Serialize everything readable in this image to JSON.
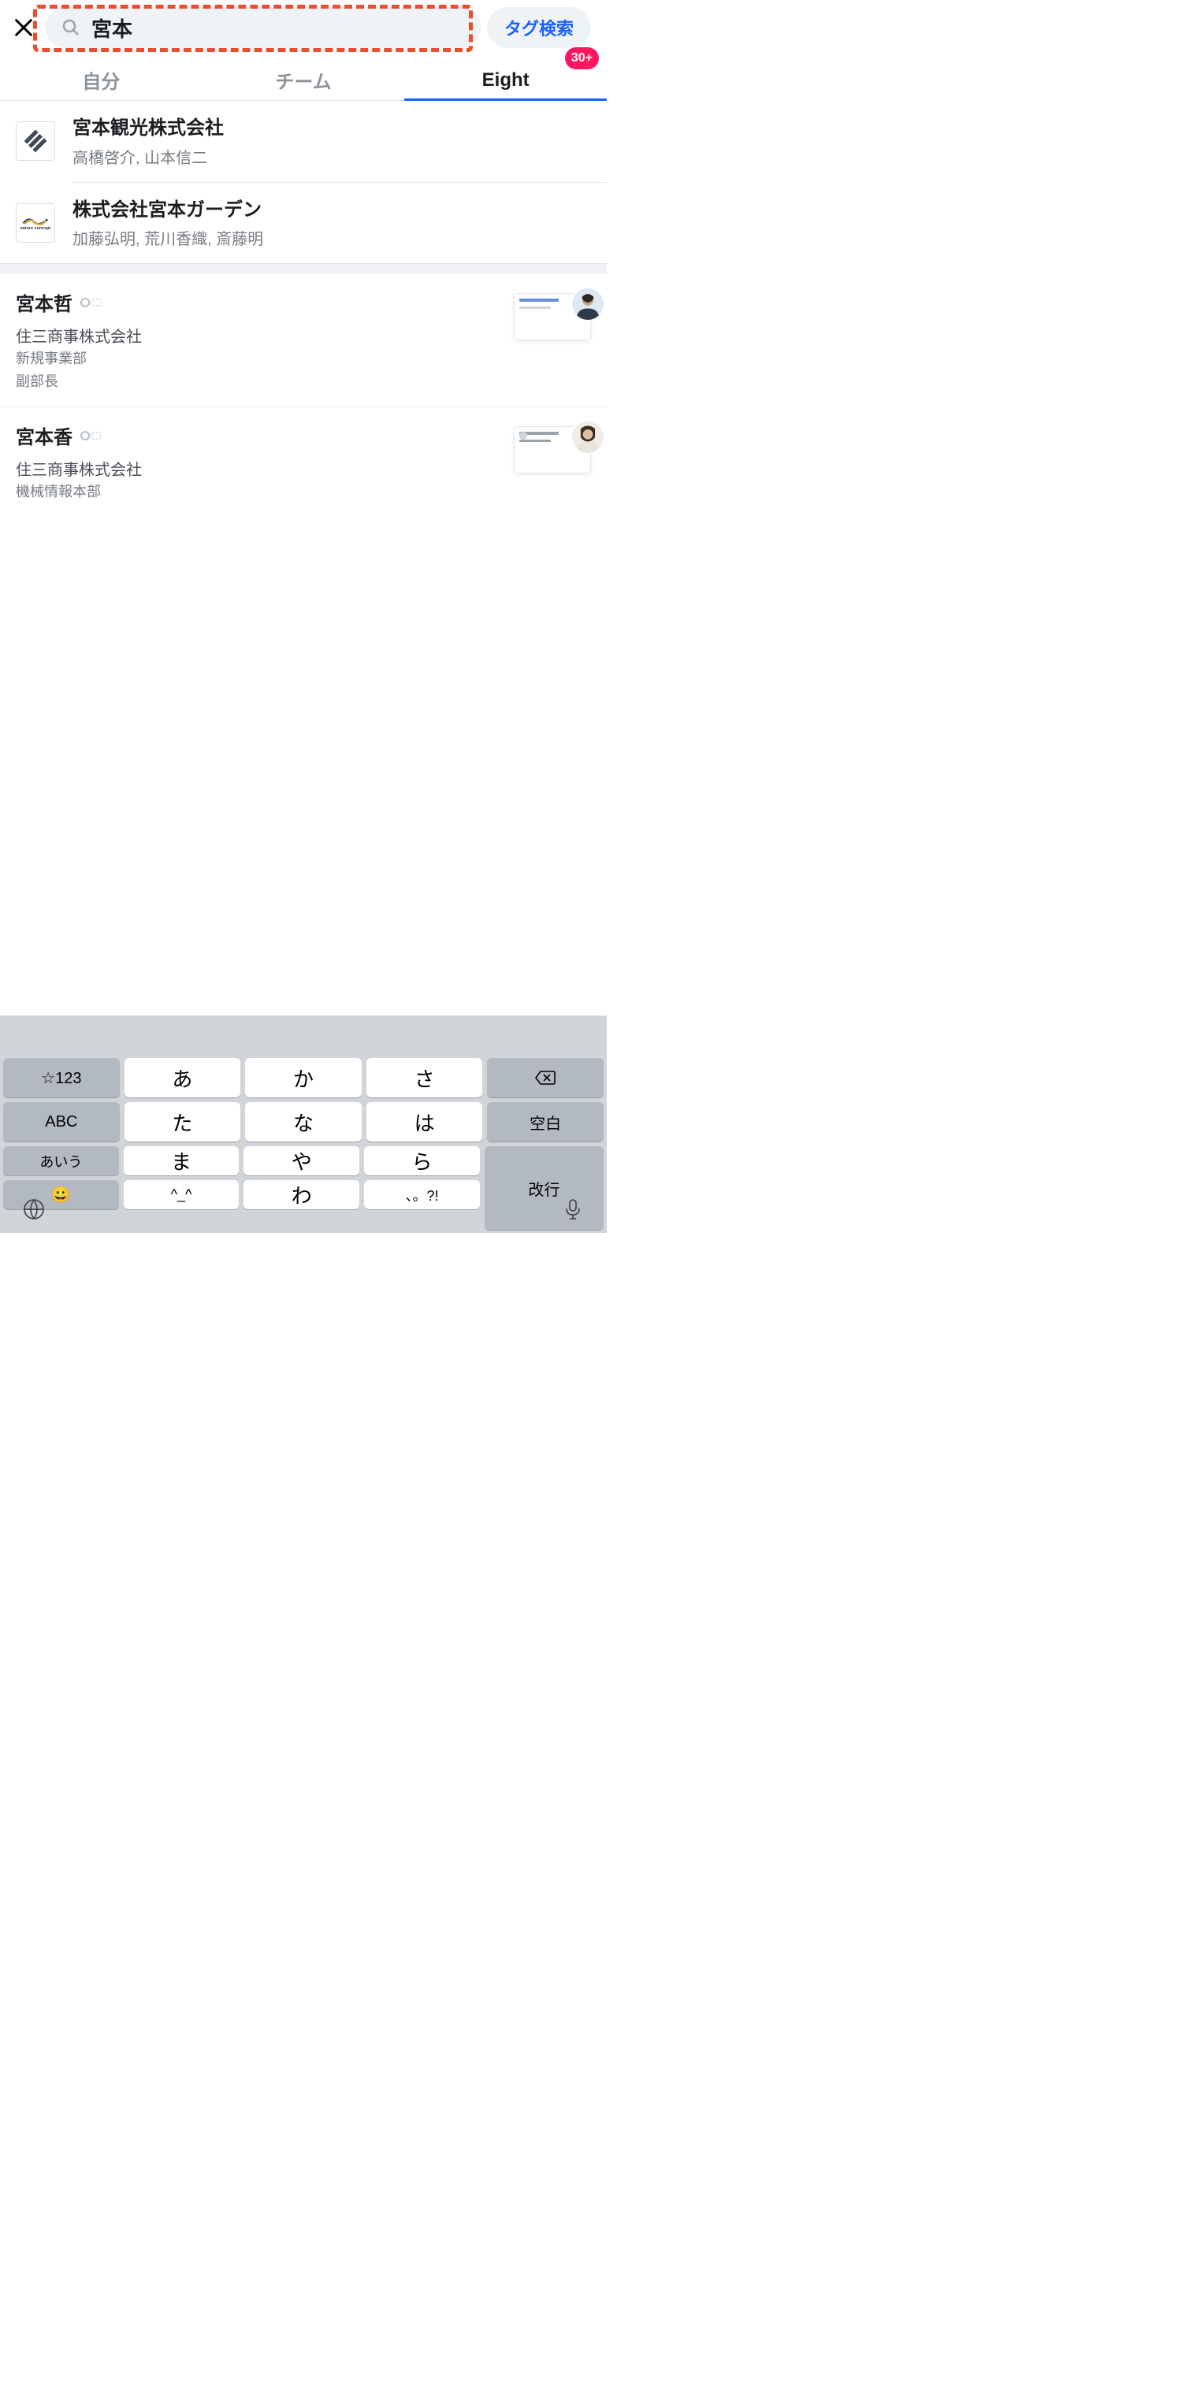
{
  "search": {
    "value": "宮本",
    "tag_button": "タグ検索"
  },
  "tabs": {
    "items": [
      {
        "label": "自分"
      },
      {
        "label": "チーム"
      },
      {
        "label": "Eight",
        "badge": "30+",
        "active": true
      }
    ]
  },
  "companies": [
    {
      "name": "宮本観光株式会社",
      "members": "高橋啓介, 山本信二",
      "logo": "diamond"
    },
    {
      "name": "株式会社宮本ガーデン",
      "members": "加藤弘明, 荒川香織, 斎藤明",
      "logo": "nature",
      "logo_text": "nature concept"
    }
  ],
  "people": [
    {
      "name": "宮本哲",
      "company": "住三商事株式会社",
      "dept": "新規事業部",
      "title": "副部長"
    },
    {
      "name": "宮本香",
      "company": "住三商事株式会社",
      "dept": "機械情報本部",
      "title": ""
    }
  ],
  "keyboard": {
    "rows": [
      [
        "☆123",
        "あ",
        "か",
        "さ",
        "⌫"
      ],
      [
        "ABC",
        "た",
        "な",
        "は",
        "空白"
      ],
      [
        "あいう",
        "ま",
        "や",
        "ら"
      ],
      [
        "😀",
        "^_^",
        "わ",
        "、。?!"
      ]
    ],
    "enter": "改行"
  }
}
